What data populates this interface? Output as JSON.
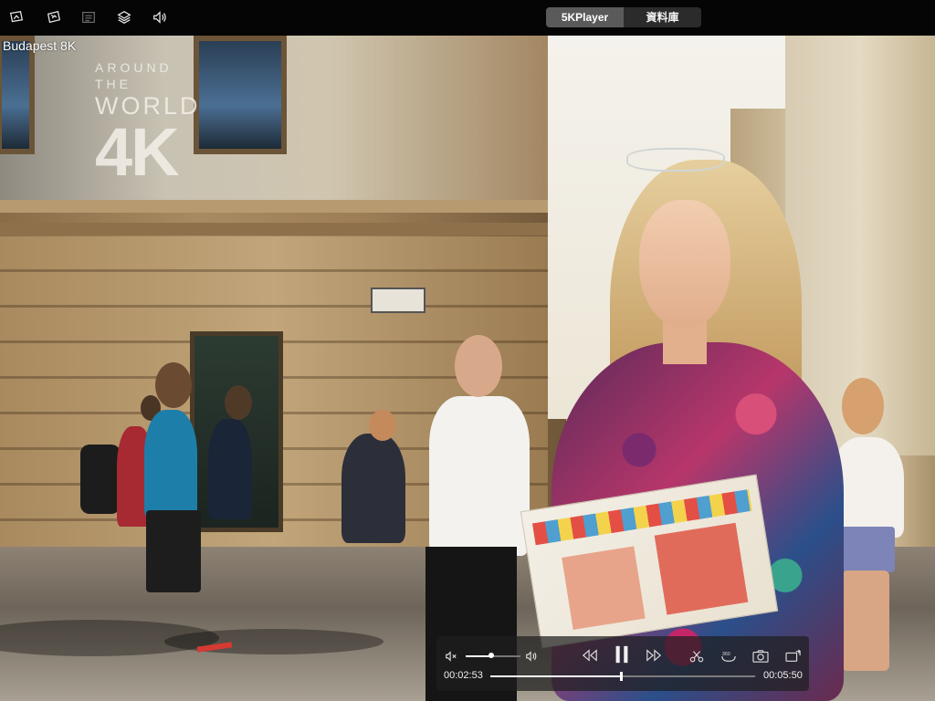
{
  "app": {
    "segmented": {
      "player_label": "5KPlayer",
      "library_label": "資料庫"
    },
    "toolbar_icons": [
      "airplay-icon",
      "airplay-screen-icon",
      "subtitles-icon",
      "layers-icon",
      "sound-icon"
    ]
  },
  "video": {
    "title": "Budapest 8K",
    "watermark": {
      "line1": "AROUND THE",
      "line2": "WORLD",
      "line3": "4K"
    }
  },
  "controls": {
    "current_time": "00:02:53",
    "total_time": "00:05:50",
    "progress_fraction": 0.494,
    "volume_fraction": 0.47,
    "state": "playing",
    "icons": [
      "mute-icon",
      "volume-icon",
      "rewind-icon",
      "pause-icon",
      "fast-forward-icon",
      "cut-icon",
      "360-icon",
      "snapshot-icon",
      "rotate-icon"
    ]
  },
  "colors": {
    "toolbar_bg": "#050505",
    "segment_active": "#5a5a5a",
    "segment_inactive": "#2b2b2b",
    "control_bar_bg": "rgba(30,30,30,0.72)"
  }
}
